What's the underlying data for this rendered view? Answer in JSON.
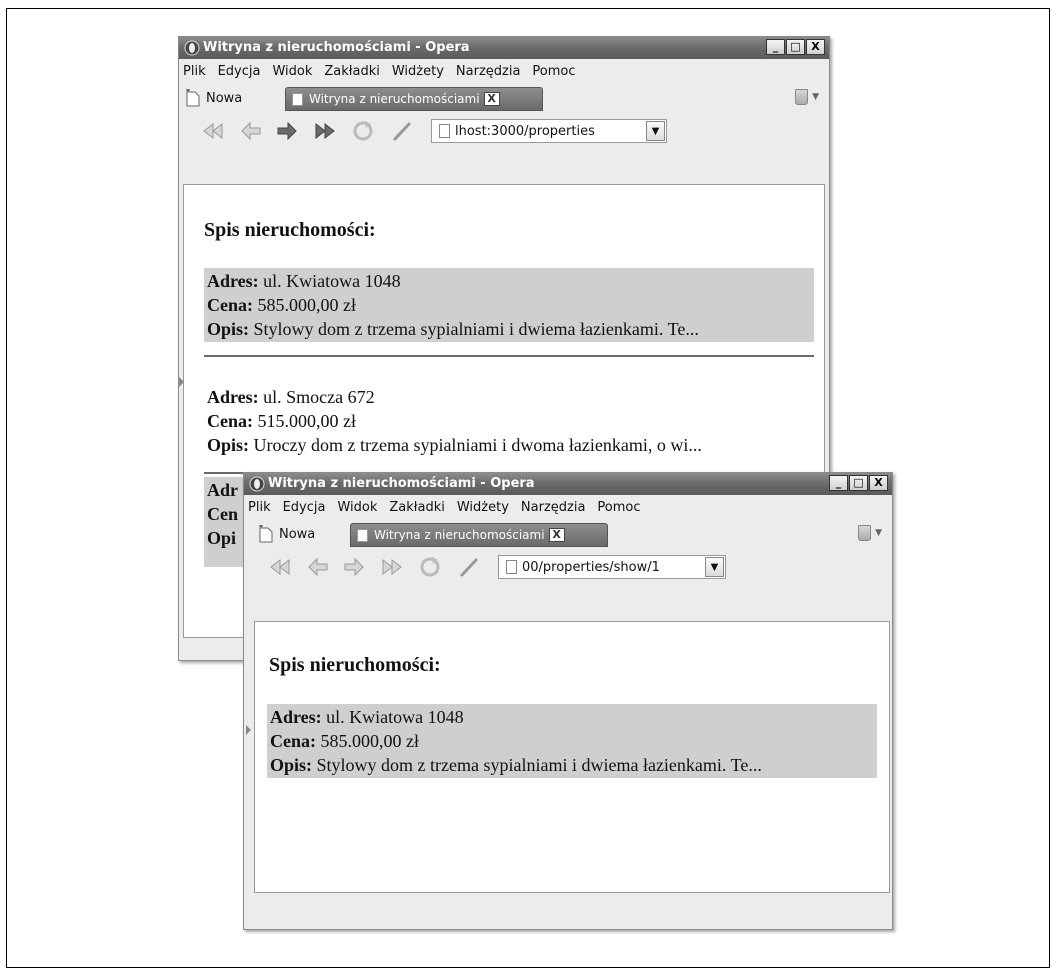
{
  "window_back": {
    "title": "Witryna z nieruchomościami - Opera",
    "menu": [
      "Plik",
      "Edycja",
      "Widok",
      "Zakładki",
      "Widżety",
      "Narzędzia",
      "Pomoc"
    ],
    "tab_new_label": "Nowa",
    "tab_active_label": "Witryna z nieruchomościami",
    "address": "lhost:3000/properties",
    "heading": "Spis nieruchomości:",
    "properties": [
      {
        "adres_label": "Adres:",
        "adres": "ul. Kwiatowa 1048",
        "cena_label": "Cena:",
        "cena": "585.000,00 zł",
        "opis_label": "Opis:",
        "opis": "Stylowy dom z trzema sypialniami i dwiema łazienkami. Te..."
      },
      {
        "adres_label": "Adres:",
        "adres": "ul. Smocza 672",
        "cena_label": "Cena:",
        "cena": "515.000,00 zł",
        "opis_label": "Opis:",
        "opis": "Uroczy dom z trzema sypialniami i dwoma łazienkami, o wi..."
      },
      {
        "adres_label": "Adr",
        "cena_label": "Cen",
        "opis_label": "Opi"
      }
    ]
  },
  "window_front": {
    "title": "Witryna z nieruchomościami - Opera",
    "menu": [
      "Plik",
      "Edycja",
      "Widok",
      "Zakładki",
      "Widżety",
      "Narzędzia",
      "Pomoc"
    ],
    "tab_new_label": "Nowa",
    "tab_active_label": "Witryna z nieruchomościami",
    "address": "00/properties/show/1",
    "heading": "Spis nieruchomości:",
    "property": {
      "adres_label": "Adres:",
      "adres": "ul. Kwiatowa 1048",
      "cena_label": "Cena:",
      "cena": "585.000,00 zł",
      "opis_label": "Opis:",
      "opis": "Stylowy dom z trzema sypialniami i dwiema łazienkami. Te..."
    }
  },
  "window_buttons": {
    "minimize": "_",
    "maximize": "□",
    "close": "X"
  },
  "icons": [
    "opera-logo-icon",
    "new-tab-icon",
    "document-icon",
    "tab-close-icon",
    "trash-icon",
    "rewind-icon",
    "back-icon",
    "forward-icon",
    "fast-forward-icon",
    "reload-icon",
    "edit-icon",
    "dropdown-arrow-icon"
  ]
}
